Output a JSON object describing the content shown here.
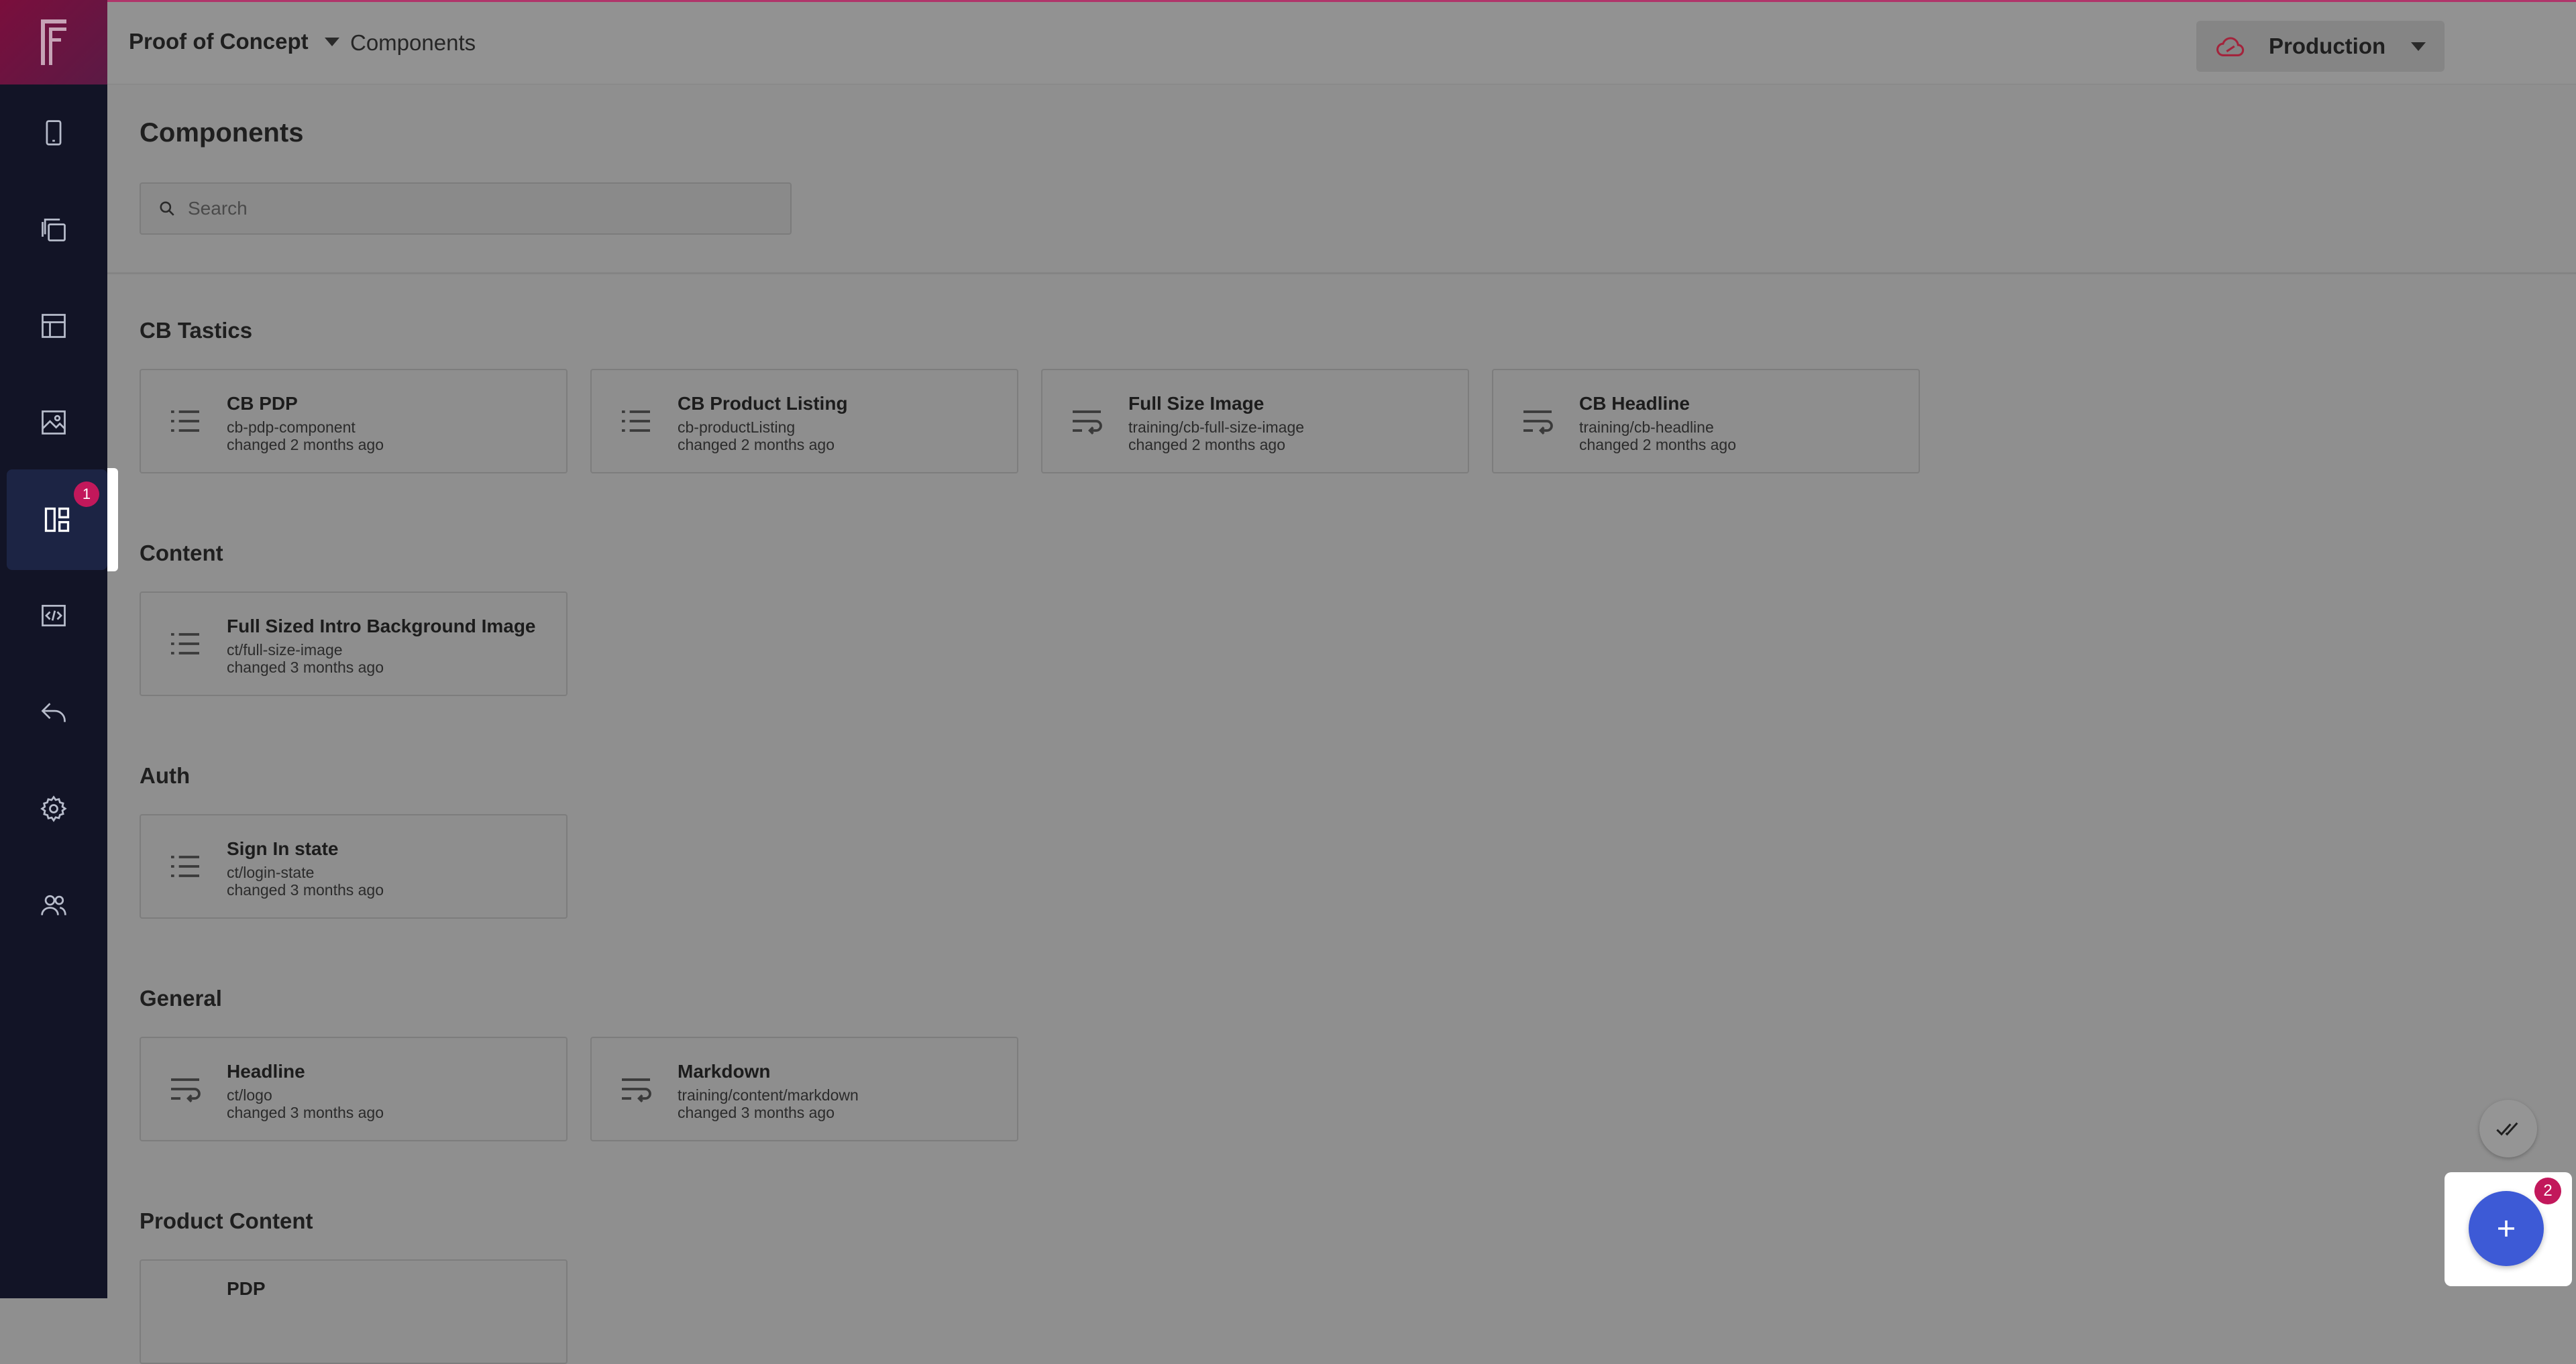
{
  "topbar": {
    "project_name": "Proof of Concept",
    "breadcrumb_current": "Components",
    "environment": "Production"
  },
  "sidebar": {
    "items": [
      {
        "icon": "mobile-icon"
      },
      {
        "icon": "copy-pages-icon"
      },
      {
        "icon": "layout-icon"
      },
      {
        "icon": "image-icon"
      },
      {
        "icon": "components-dashboard-icon",
        "badge": "1",
        "active": true
      },
      {
        "icon": "code-icon"
      },
      {
        "icon": "undo-arrow-icon"
      },
      {
        "icon": "gear-icon"
      },
      {
        "icon": "users-icon"
      }
    ]
  },
  "main": {
    "title": "Components",
    "search_placeholder": "Search",
    "sections": [
      {
        "title": "CB Tastics",
        "cards": [
          {
            "name": "CB PDP",
            "key": "cb-pdp-component",
            "changed": "changed 2 months ago",
            "icon": "list-icon"
          },
          {
            "name": "CB Product Listing",
            "key": "cb-productListing",
            "changed": "changed 2 months ago",
            "icon": "list-icon"
          },
          {
            "name": "Full Size Image",
            "key": "training/cb-full-size-image",
            "changed": "changed 2 months ago",
            "icon": "wrap-text-icon"
          },
          {
            "name": "CB Headline",
            "key": "training/cb-headline",
            "changed": "changed 2 months ago",
            "icon": "wrap-text-icon"
          }
        ]
      },
      {
        "title": "Content",
        "cards": [
          {
            "name": "Full Sized Intro Background Image",
            "key": "ct/full-size-image",
            "changed": "changed 3 months ago",
            "icon": "list-icon"
          }
        ]
      },
      {
        "title": "Auth",
        "cards": [
          {
            "name": "Sign In state",
            "key": "ct/login-state",
            "changed": "changed 3 months ago",
            "icon": "list-icon"
          }
        ]
      },
      {
        "title": "General",
        "cards": [
          {
            "name": "Headline",
            "key": "ct/logo",
            "changed": "changed 3 months ago",
            "icon": "wrap-text-icon"
          },
          {
            "name": "Markdown",
            "key": "training/content/markdown",
            "changed": "changed 3 months ago",
            "icon": "wrap-text-icon"
          }
        ]
      },
      {
        "title": "Product Content",
        "cards": [
          {
            "name": "PDP",
            "key": "",
            "changed": "",
            "icon": "list-icon"
          }
        ]
      }
    ]
  },
  "fab": {
    "badge": "2"
  },
  "colors": {
    "sidebar": "#121426",
    "accent": "#3d5ad6",
    "badge": "#c2185b",
    "brand": "#7a0e3c"
  }
}
